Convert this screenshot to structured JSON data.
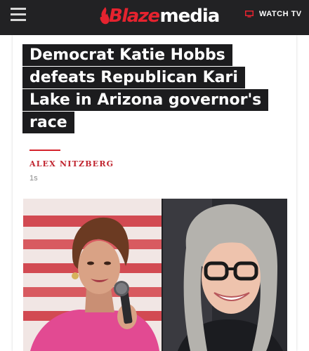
{
  "header": {
    "logo_text_red": "Blaze",
    "logo_text_white": "media",
    "watch_tv_label": "WATCH TV"
  },
  "article": {
    "headline": "Democrat Katie Hobbs defeats Republican Kari Lake in Arizona governor's race",
    "author": "ALEX NITZBERG",
    "timestamp": "1s"
  },
  "colors": {
    "brand_red": "#e5232f",
    "topbar": "#222224",
    "headline_bg": "#1c1c1e"
  },
  "icons": {
    "menu": "hamburger-menu-icon",
    "tv": "tv-icon"
  }
}
